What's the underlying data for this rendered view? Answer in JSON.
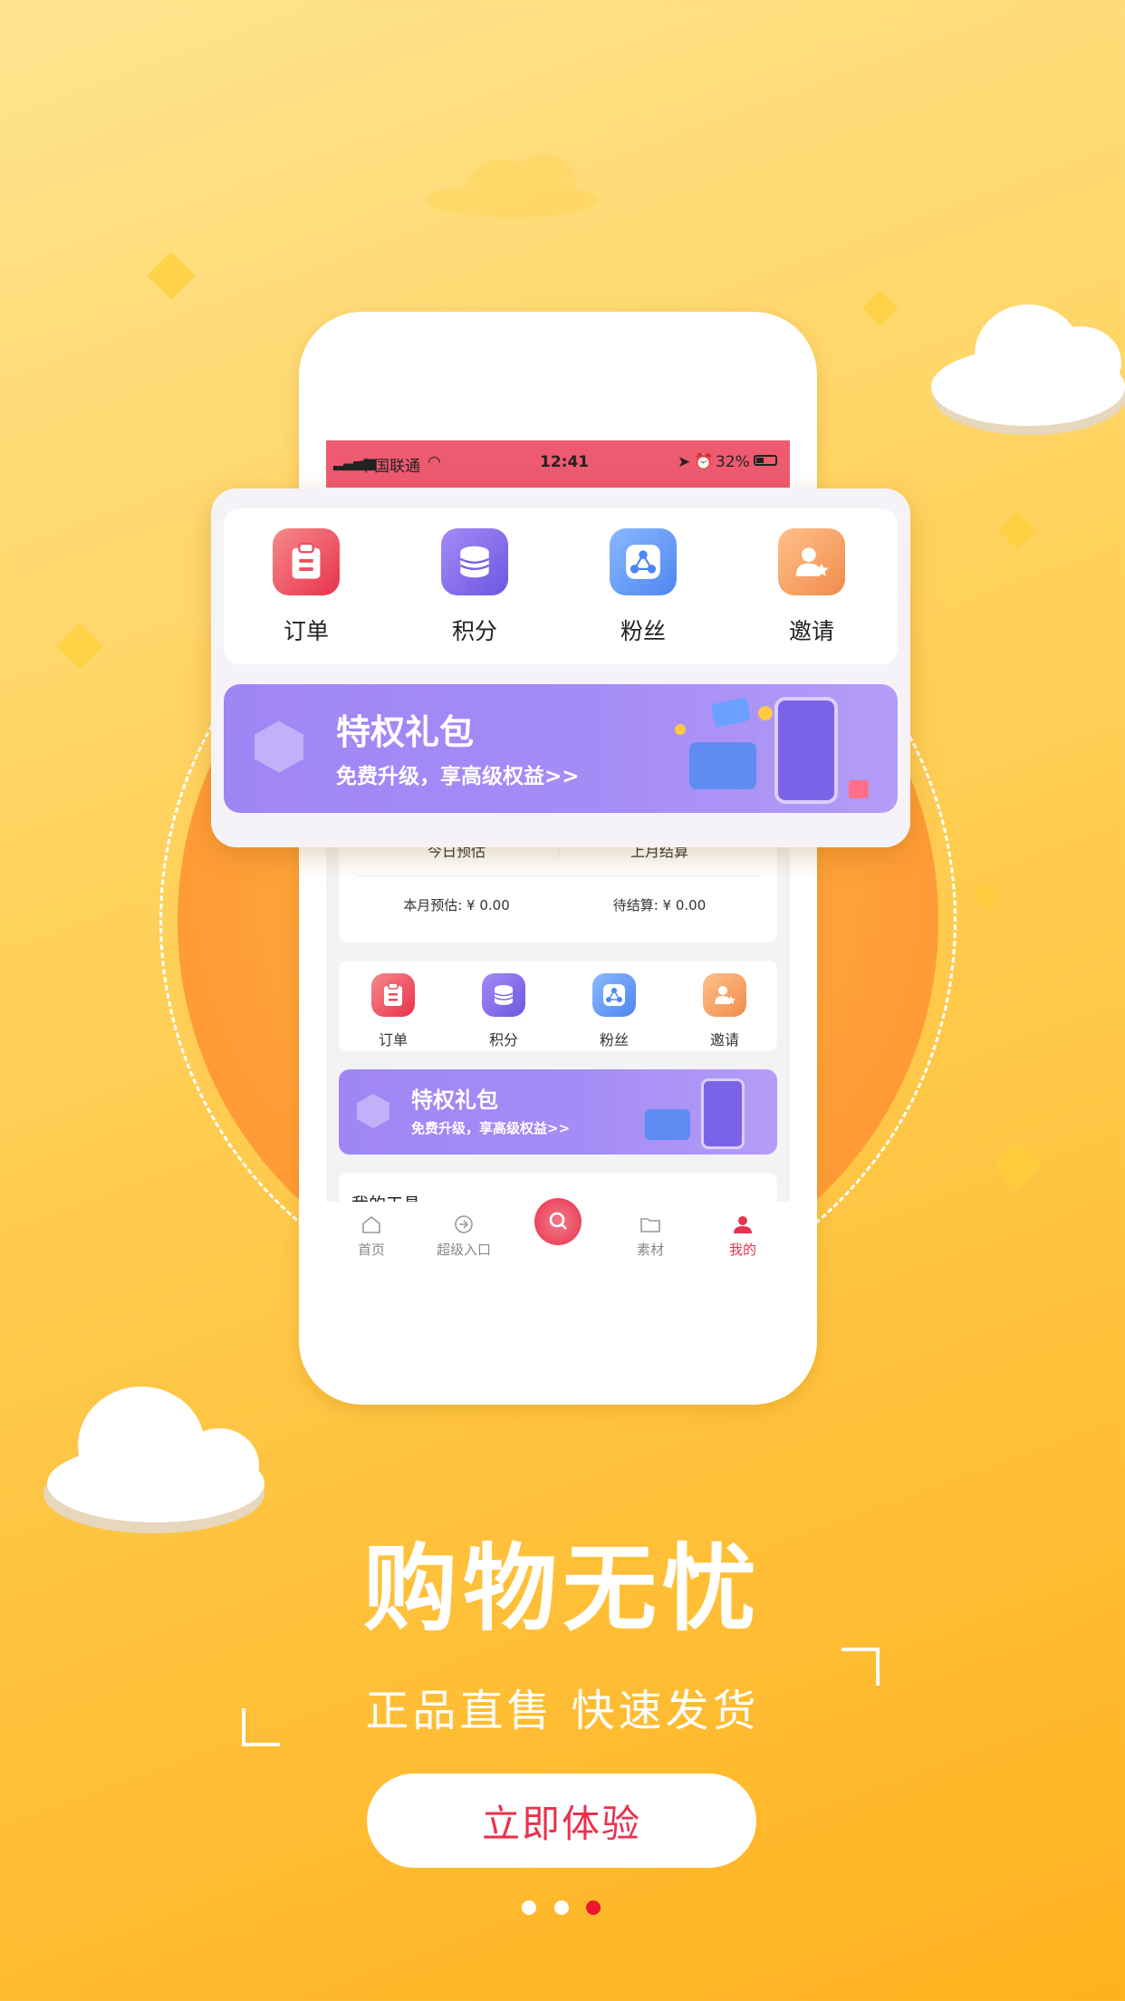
{
  "status_bar": {
    "carrier": "中国联通",
    "time": "12:41",
    "battery": "32%"
  },
  "float_card": {
    "items": [
      {
        "label": "订单",
        "icon": "order-clipboard-icon"
      },
      {
        "label": "积分",
        "icon": "points-coins-icon"
      },
      {
        "label": "粉丝",
        "icon": "fans-share-icon"
      },
      {
        "label": "邀请",
        "icon": "invite-user-icon"
      }
    ],
    "banner": {
      "title": "特权礼包",
      "subtitle": "免费升级，享高级权益>>"
    }
  },
  "earnings": {
    "today_label": "今日预估",
    "last_month_label": "上月结算",
    "month_estimate": "本月预估: ¥ 0.00",
    "pending": "待结算: ¥ 0.00"
  },
  "mini_items": [
    {
      "label": "订单"
    },
    {
      "label": "积分"
    },
    {
      "label": "粉丝"
    },
    {
      "label": "邀请"
    }
  ],
  "mini_banner": {
    "title": "特权礼包",
    "subtitle": "免费升级，享高级权益>>"
  },
  "tools_title": "我的工具",
  "tabbar": {
    "items": [
      {
        "label": "首页"
      },
      {
        "label": "超级入口"
      },
      {
        "label": ""
      },
      {
        "label": "素材"
      },
      {
        "label": "我的"
      }
    ],
    "active_color": "#e8324d"
  },
  "headline": "购物无忧",
  "subline": "正品直售 快速发货",
  "cta_label": "立即体验",
  "pager": {
    "count": 3,
    "active": 3
  }
}
